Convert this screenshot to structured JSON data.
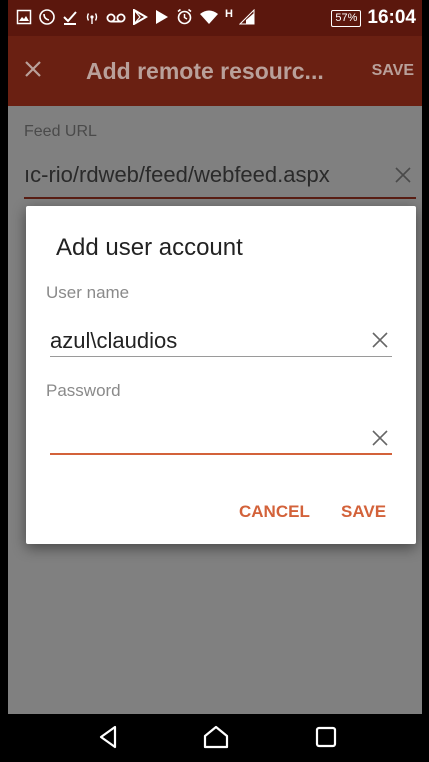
{
  "status_bar": {
    "icons": [
      "gallery-icon",
      "whatsapp-icon",
      "download-done-icon",
      "hotspot-icon",
      "voicemail-icon",
      "play-store-icon",
      "play-icon",
      "alarm-icon",
      "wifi-icon",
      "network-h-icon",
      "signal-icon"
    ],
    "network_type": "H",
    "battery": "57%",
    "time": "16:04"
  },
  "app_bar": {
    "title": "Add remote resourc...",
    "save_label": "SAVE"
  },
  "form": {
    "feed_url_label": "Feed URL",
    "feed_url_value": "ıc-rio/rdweb/feed/webfeed.aspx"
  },
  "dialog": {
    "title": "Add user account",
    "username_label": "User name",
    "username_value": "azul\\claudios",
    "password_label": "Password",
    "password_value": "",
    "cancel_label": "CANCEL",
    "save_label": "SAVE"
  },
  "colors": {
    "status_bar": "#5b170d",
    "app_bar": "#6a2012",
    "accent": "#d3623a",
    "scrim": "#808080"
  },
  "nav_bar": {
    "icons": [
      "back-icon",
      "home-icon",
      "recents-icon"
    ]
  }
}
